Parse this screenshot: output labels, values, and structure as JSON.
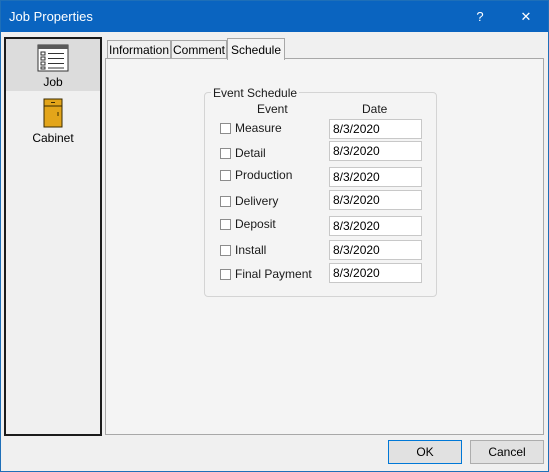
{
  "window": {
    "title": "Job Properties",
    "help_glyph": "?",
    "close_glyph": "✕"
  },
  "nav": {
    "items": [
      {
        "label": "Job",
        "icon": "checklist-icon",
        "selected": true
      },
      {
        "label": "Cabinet",
        "icon": "cabinet-icon",
        "selected": false
      }
    ]
  },
  "tabs": [
    {
      "label": "Information"
    },
    {
      "label": "Comment"
    },
    {
      "label": "Schedule",
      "active": true
    }
  ],
  "schedule": {
    "group_title": "Event Schedule",
    "event_header": "Event",
    "date_header": "Date",
    "rows": [
      {
        "event": "Measure",
        "date": "8/3/2020",
        "checked": false
      },
      {
        "event": "Detail",
        "date": "8/3/2020",
        "checked": false
      },
      {
        "event": "Production",
        "date": "8/3/2020",
        "checked": false
      },
      {
        "event": "Delivery",
        "date": "8/3/2020",
        "checked": false
      },
      {
        "event": "Deposit",
        "date": "8/3/2020",
        "checked": false
      },
      {
        "event": "Install",
        "date": "8/3/2020",
        "checked": false
      },
      {
        "event": "Final Payment",
        "date": "8/3/2020",
        "checked": false
      }
    ]
  },
  "buttons": {
    "ok": "OK",
    "cancel": "Cancel"
  },
  "colors": {
    "titlebar": "#0a64c0",
    "cabinet_fill": "#e3a51a"
  }
}
